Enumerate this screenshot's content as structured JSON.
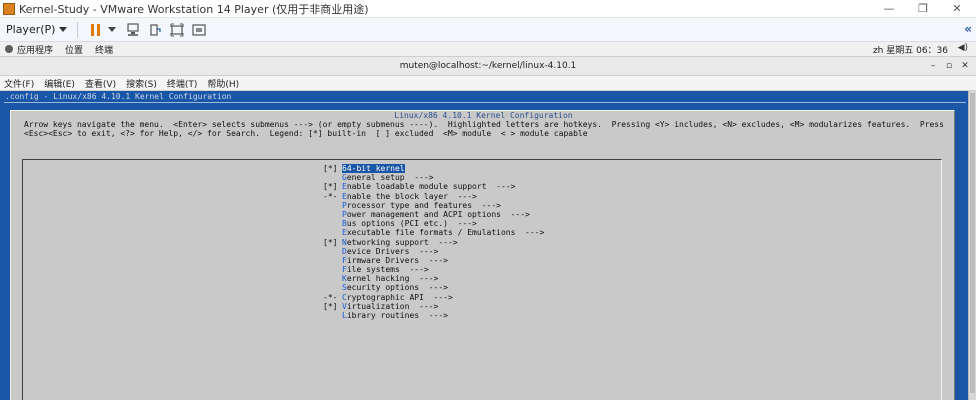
{
  "vmware": {
    "title": "Kernel-Study - VMware Workstation 14 Player (仅用于非商业用途)",
    "player_menu": "Player(P)",
    "colors": {
      "accent": "#e07b10",
      "link": "#2a5db0"
    }
  },
  "gnome_panel": {
    "items": [
      "应用程序",
      "位置",
      "终端"
    ],
    "clock": "zh  星期五 06：36",
    "speaker_icon": "speaker-icon"
  },
  "terminal": {
    "title": "muten@localhost:~/kernel/linux-4.10.1",
    "menu": [
      "文件(F)",
      "编辑(E)",
      "查看(V)",
      "搜索(S)",
      "终端(T)",
      "帮助(H)"
    ]
  },
  "menuconfig": {
    "path_line": ".config - Linux/x86 4.10.1 Kernel Configuration",
    "dialog_title": "Linux/x86 4.10.1 Kernel Configuration",
    "help_line1": "Arrow keys navigate the menu.  <Enter> selects submenus ---> (or empty submenus ----).  Highlighted letters are hotkeys.  Pressing <Y> includes, <N> excludes, <M> modularizes features.  Press",
    "help_line2": "<Esc><Esc> to exit, <?> for Help, </> for Search.  Legend: [*] built-in  [ ] excluded  <M> module  < > module capable",
    "colors": {
      "screen_bg": "#1a56a8",
      "dialog_bg": "#c9c9c9",
      "hotkey": "#1b5bd1"
    },
    "items": [
      {
        "mark": "[*]",
        "hot": "6",
        "rest": "4-bit kernel",
        "selected": true
      },
      {
        "mark": "",
        "hot": "G",
        "rest": "eneral setup  --->",
        "selected": false
      },
      {
        "mark": "[*]",
        "hot": "E",
        "rest": "nable loadable module support  --->",
        "selected": false
      },
      {
        "mark": "-*-",
        "hot": "E",
        "rest": "nable the block layer  --->",
        "selected": false
      },
      {
        "mark": "",
        "hot": "P",
        "rest": "rocessor type and features  --->",
        "selected": false
      },
      {
        "mark": "",
        "hot": "P",
        "rest": "ower management and ACPI options  --->",
        "selected": false
      },
      {
        "mark": "",
        "hot": "B",
        "rest": "us options (PCI etc.)  --->",
        "selected": false
      },
      {
        "mark": "",
        "hot": "E",
        "rest": "xecutable file formats / Emulations  --->",
        "selected": false
      },
      {
        "mark": "[*]",
        "hot": "N",
        "rest": "etworking support  --->",
        "selected": false
      },
      {
        "mark": "",
        "hot": "D",
        "rest": "evice Drivers  --->",
        "selected": false
      },
      {
        "mark": "",
        "hot": "F",
        "rest": "irmware Drivers  --->",
        "selected": false
      },
      {
        "mark": "",
        "hot": "F",
        "rest": "ile systems  --->",
        "selected": false
      },
      {
        "mark": "",
        "hot": "K",
        "rest": "ernel hacking  --->",
        "selected": false
      },
      {
        "mark": "",
        "hot": "S",
        "rest": "ecurity options  --->",
        "selected": false
      },
      {
        "mark": "-*-",
        "hot": "C",
        "rest": "ryptographic API  --->",
        "selected": false
      },
      {
        "mark": "[*]",
        "hot": "V",
        "rest": "irtualization  --->",
        "selected": false
      },
      {
        "mark": "",
        "hot": "L",
        "rest": "ibrary routines  --->",
        "selected": false
      }
    ]
  }
}
